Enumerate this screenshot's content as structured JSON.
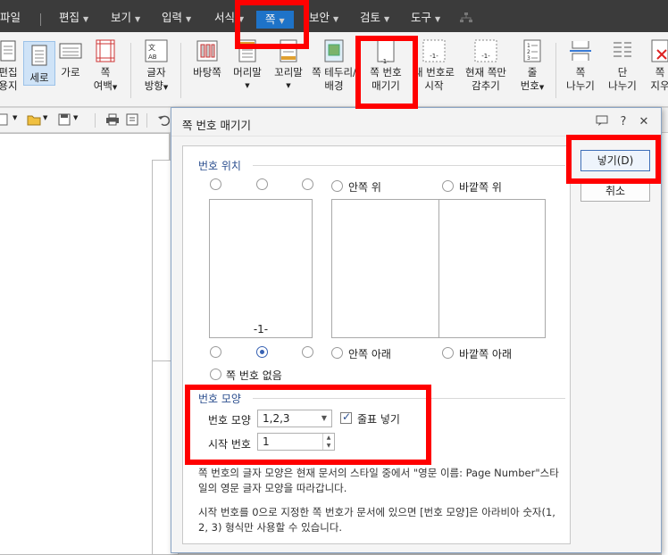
{
  "menubar": {
    "items": [
      {
        "label": "파일",
        "caret": false
      },
      {
        "label": "편집",
        "caret": true
      },
      {
        "label": "보기",
        "caret": true
      },
      {
        "label": "입력",
        "caret": true
      },
      {
        "label": "서식",
        "caret": true
      },
      {
        "label": "쪽",
        "caret": true
      },
      {
        "label": "보안",
        "caret": true
      },
      {
        "label": "검토",
        "caret": true
      },
      {
        "label": "도구",
        "caret": true
      }
    ],
    "caret_glyph": "▼"
  },
  "ribbon": {
    "edit_paper": [
      "편집",
      "용지"
    ],
    "portrait": "세로",
    "landscape": "가로",
    "margin": [
      "쪽",
      "여백"
    ],
    "text_direction": [
      "글자",
      "방향"
    ],
    "background": "바탕쪽",
    "header": "머리말",
    "footer": "꼬리말",
    "border_bg": [
      "쪽 테두리/",
      "배경"
    ],
    "page_number": [
      "쪽 번호",
      "매기기"
    ],
    "new_number": [
      "새 번호로",
      "시작"
    ],
    "hide_current": [
      "현재 쪽만",
      "감추기"
    ],
    "line_number": [
      "줄",
      "번호"
    ],
    "page_break": [
      "쪽",
      "나누기"
    ],
    "col_break": [
      "단",
      "나누기"
    ],
    "erase": [
      "쪽",
      "지우"
    ],
    "page_number_icon_text": "-1-",
    "new_number_icon_text": "-1-",
    "hide_icon_text": "-1-",
    "text_dir_icon": "文字"
  },
  "dialog": {
    "title": "쪽 번호 매기기",
    "position_group": "번호 위치",
    "inner_top": "안쪽 위",
    "outer_top": "바깥쪽 위",
    "inner_bottom": "안쪽 아래",
    "outer_bottom": "바깥쪽 아래",
    "no_number": "쪽 번호 없음",
    "preview_number": "-1-",
    "format_group": "번호 모양",
    "format_label": "번호 모양",
    "format_value": "1,2,3",
    "dash_label": "줄표 넣기",
    "dash_checked": true,
    "start_label": "시작 번호",
    "start_value": "1",
    "help1": "쪽 번호의 글자 모양은 현재 문서의 스타일 중에서 \"영문 이름: Page Number\"스타일의 영문 글자 모양을 따라갑니다.",
    "help2": "시작 번호를 0으로 지정한 쪽 번호가 문서에 있으면 [번호 모양]은 아라비아 숫자(1, 2, 3) 형식만 사용할 수 있습니다.",
    "ok_button": "넣기(D)",
    "cancel_button": "취소",
    "selected_position": "bottom-center"
  },
  "colors": {
    "highlight": "#ff0000",
    "menu_bg": "#3b3b3b",
    "menu_active": "#1e73c8",
    "accent": "#2c4f8f"
  }
}
